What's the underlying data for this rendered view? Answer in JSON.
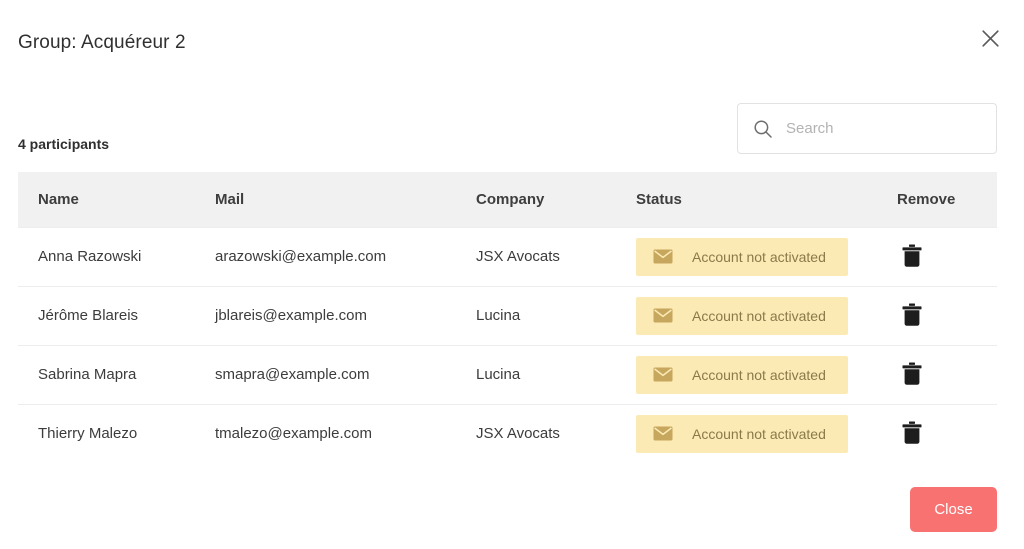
{
  "dialog": {
    "title": "Group: Acquéreur 2",
    "close_icon": "close-icon",
    "participants_label": "4 participants",
    "footer_button_label": "Close",
    "accent_color": "#f97272",
    "badge_bg_color": "#fbeab4",
    "badge_text_color": "#8a7a4a",
    "header_bg_color": "#f1f1f1"
  },
  "search": {
    "placeholder": "Search",
    "value": "",
    "icon": "search-icon"
  },
  "table": {
    "columns": [
      {
        "key": "name",
        "label": "Name"
      },
      {
        "key": "mail",
        "label": "Mail"
      },
      {
        "key": "company",
        "label": "Company"
      },
      {
        "key": "status",
        "label": "Status"
      },
      {
        "key": "remove",
        "label": "Remove"
      }
    ],
    "rows": [
      {
        "name": "Anna Razowski",
        "mail": "arazowski@example.com",
        "company": "JSX Avocats",
        "status": "Account not activated",
        "status_icon": "envelope-icon",
        "remove_icon": "trash-icon"
      },
      {
        "name": "Jérôme Blareis",
        "mail": "jblareis@example.com",
        "company": "Lucina",
        "status": "Account not activated",
        "status_icon": "envelope-icon",
        "remove_icon": "trash-icon"
      },
      {
        "name": "Sabrina Mapra",
        "mail": "smapra@example.com",
        "company": "Lucina",
        "status": "Account not activated",
        "status_icon": "envelope-icon",
        "remove_icon": "trash-icon"
      },
      {
        "name": "Thierry Malezo",
        "mail": "tmalezo@example.com",
        "company": "JSX Avocats",
        "status": "Account not activated",
        "status_icon": "envelope-icon",
        "remove_icon": "trash-icon"
      }
    ]
  }
}
